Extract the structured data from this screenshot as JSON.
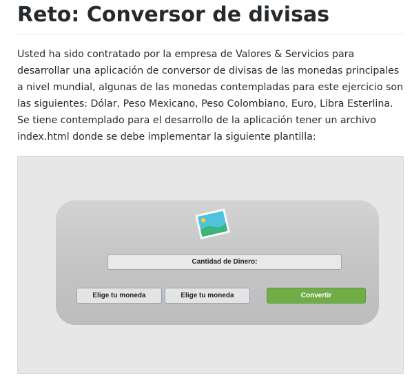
{
  "header": {
    "title": "Reto: Conversor de divisas"
  },
  "intro": {
    "text": "Usted ha sido contratado por la empresa de Valores & Servicios para desarrollar una aplicación de conversor de divisas de las monedas principales a nivel mundial, algunas de las monedas contempladas para este ejercicio son las siguientes: Dólar, Peso Mexicano, Peso Colombiano, Euro, Libra Esterlina. Se tiene contemplado para el desarrollo de la aplicación tener un archivo index.html donde se debe implementar la siguiente plantilla:"
  },
  "template": {
    "icon": "image-icon",
    "amount_label": "Cantidad de Dinero:",
    "currency_from_label": "Elige tu moneda",
    "currency_to_label": "Elige tu moneda",
    "convert_label": "Convertir"
  },
  "colors": {
    "convert_button": "#71ad47",
    "figure_background": "#e7e7e7",
    "card_background": "#c9c9c9",
    "icon_sky": "#4fc3dc",
    "icon_hill": "#3db47a",
    "icon_sun": "#f4d03f"
  }
}
